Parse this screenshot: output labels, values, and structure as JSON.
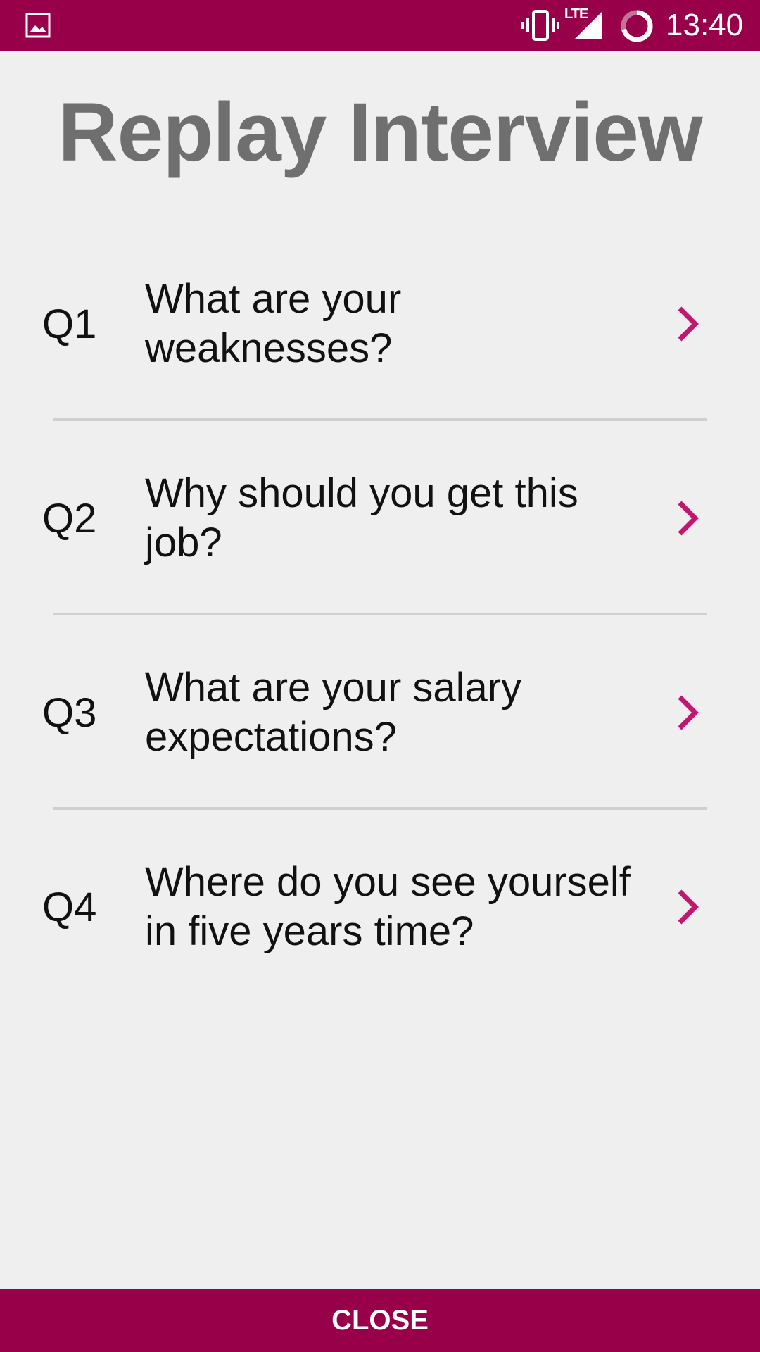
{
  "status_bar": {
    "time": "13:40",
    "network": "LTE",
    "icons": [
      "gallery-icon",
      "vibrate-icon",
      "lte-signal-icon",
      "battery-icon"
    ]
  },
  "title": "Replay Interview",
  "questions": [
    {
      "number": "Q1",
      "text": "What are your weaknesses?"
    },
    {
      "number": "Q2",
      "text": "Why should you get this job?"
    },
    {
      "number": "Q3",
      "text": "What are your salary expectations?"
    },
    {
      "number": "Q4",
      "text": "Where do you see yourself in five years time?"
    }
  ],
  "close_label": "CLOSE",
  "colors": {
    "brand": "#98004a",
    "chevron": "#c2176e",
    "title": "#6f6f6f",
    "background": "#efeff0",
    "divider": "#cfcfcf"
  }
}
